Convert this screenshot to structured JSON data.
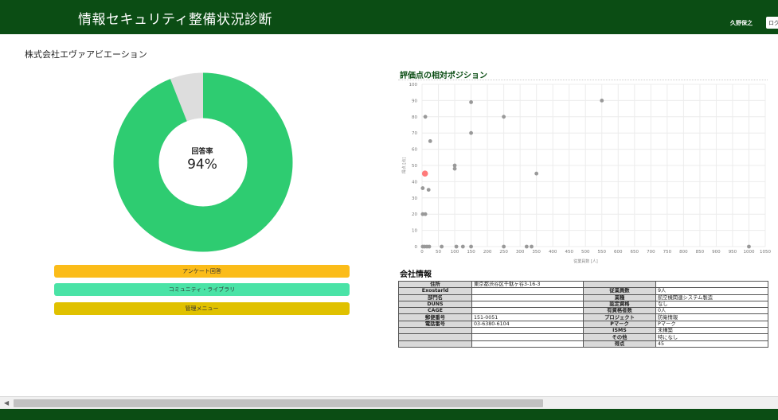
{
  "header": {
    "title": "情報セキュリティ整備状況診断",
    "user_name": "久野保之",
    "logout_label": "ログ"
  },
  "company_name": "株式会社エヴァアビエーション",
  "response": {
    "label": "回答率",
    "value": "94%",
    "rate": 0.94,
    "answered_color": "#2ecc71",
    "remaining_color": "#dddddd"
  },
  "menu": {
    "survey": "アンケート回答",
    "community": "コミュニティ・ライブラリ",
    "admin": "管理メニュー"
  },
  "chart_title": "評価点の相対ポジション",
  "chart_data": {
    "type": "scatter",
    "title": "評価点の相対ポジション",
    "xlabel": "従業員数 [人]",
    "ylabel": "得点 [点]",
    "xlim": [
      0,
      1050
    ],
    "ylim": [
      0,
      100
    ],
    "x_ticks": [
      0,
      50,
      100,
      150,
      200,
      250,
      300,
      350,
      400,
      450,
      500,
      550,
      600,
      650,
      700,
      750,
      800,
      850,
      900,
      950,
      1000,
      1050
    ],
    "y_ticks": [
      0,
      10,
      20,
      30,
      40,
      50,
      60,
      70,
      80,
      90,
      100
    ],
    "grid": true,
    "highlight_color": "#ff7a7a",
    "point_color": "#999999",
    "points": [
      {
        "x": 10,
        "y": 80
      },
      {
        "x": 150,
        "y": 89
      },
      {
        "x": 250,
        "y": 80
      },
      {
        "x": 550,
        "y": 90
      },
      {
        "x": 150,
        "y": 70
      },
      {
        "x": 25,
        "y": 65
      },
      {
        "x": 100,
        "y": 50
      },
      {
        "x": 100,
        "y": 48
      },
      {
        "x": 350,
        "y": 45
      },
      {
        "x": 2,
        "y": 36
      },
      {
        "x": 20,
        "y": 35
      },
      {
        "x": 2,
        "y": 20
      },
      {
        "x": 10,
        "y": 20
      },
      {
        "x": 2,
        "y": 0
      },
      {
        "x": 8,
        "y": 0
      },
      {
        "x": 15,
        "y": 0
      },
      {
        "x": 22,
        "y": 0
      },
      {
        "x": 60,
        "y": 0
      },
      {
        "x": 105,
        "y": 0
      },
      {
        "x": 125,
        "y": 0
      },
      {
        "x": 150,
        "y": 0
      },
      {
        "x": 250,
        "y": 0
      },
      {
        "x": 320,
        "y": 0
      },
      {
        "x": 335,
        "y": 0
      },
      {
        "x": 1000,
        "y": 0
      }
    ],
    "highlight": {
      "x": 9,
      "y": 45
    }
  },
  "company_info": {
    "title": "会社情報",
    "rows": [
      [
        "住所",
        "東京都渋谷区千駄ヶ谷3-16-3",
        "",
        ""
      ],
      [
        "Exostarld",
        "",
        "従業員数",
        "9人"
      ],
      [
        "部門名",
        "",
        "業種",
        "航空機関連システム製造"
      ],
      [
        "DUNS",
        "",
        "認定資格",
        "なし"
      ],
      [
        "CAGE",
        "",
        "有資格者数",
        "0人"
      ],
      [
        "郵便番号",
        "151-0051",
        "プロジェクト",
        "防衛情報"
      ],
      [
        "電話番号",
        "03-6380-6104",
        "Pマーク",
        "Pマーク"
      ],
      [
        "",
        "",
        "ISMS",
        "未構築"
      ],
      [
        "",
        "",
        "その他",
        "特になし"
      ],
      [
        "",
        "",
        "得点",
        "45"
      ]
    ]
  }
}
